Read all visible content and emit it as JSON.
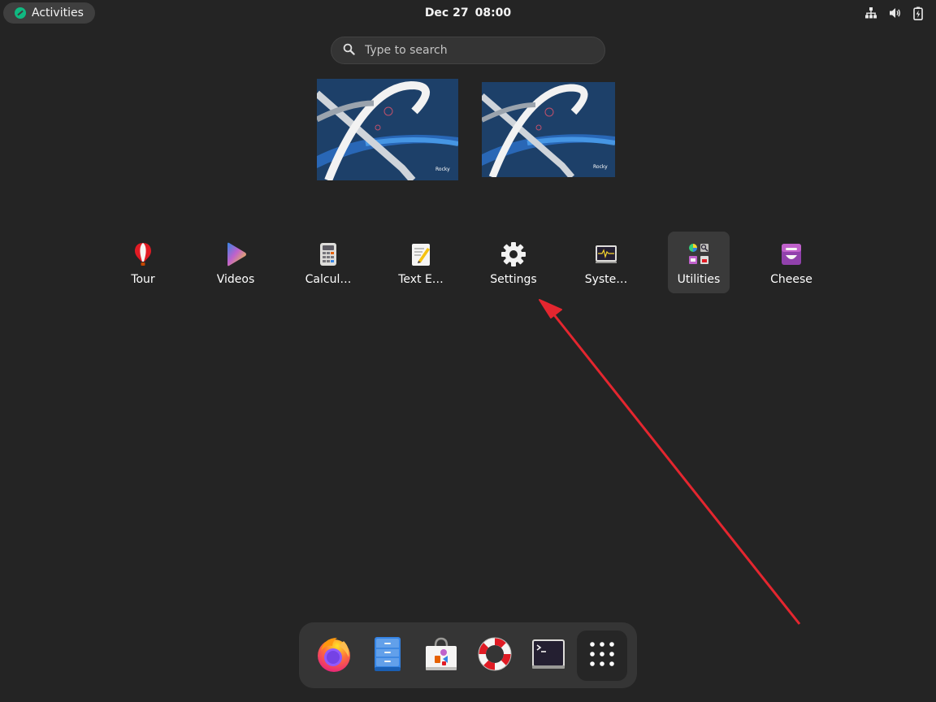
{
  "topbar": {
    "activities_label": "Activities",
    "date": "Dec 27",
    "time": "08:00",
    "tray_icons": [
      "network-wired-icon",
      "volume-icon",
      "battery-icon"
    ]
  },
  "search": {
    "placeholder": "Type to search",
    "icon": "search-icon"
  },
  "workspaces": [
    {
      "name": "workspace-1",
      "watermark": "Rocky"
    },
    {
      "name": "workspace-2",
      "watermark": "Rocky"
    }
  ],
  "apps": [
    {
      "label": "Tour",
      "icon": "balloon-icon"
    },
    {
      "label": "Videos",
      "icon": "play-icon"
    },
    {
      "label": "Calcul…",
      "icon": "calculator-icon"
    },
    {
      "label": "Text E…",
      "icon": "text-editor-icon"
    },
    {
      "label": "Settings",
      "icon": "gear-icon"
    },
    {
      "label": "Syste…",
      "icon": "system-monitor-icon"
    },
    {
      "label": "Utilities",
      "icon": "utilities-folder-icon",
      "highlighted": true
    },
    {
      "label": "Cheese",
      "icon": "cheese-icon"
    }
  ],
  "dock": [
    {
      "name": "firefox",
      "icon": "firefox-icon"
    },
    {
      "name": "files",
      "icon": "file-cabinet-icon"
    },
    {
      "name": "software",
      "icon": "software-bag-icon"
    },
    {
      "name": "help",
      "icon": "lifebuoy-icon"
    },
    {
      "name": "terminal",
      "icon": "terminal-icon"
    },
    {
      "name": "show-apps",
      "icon": "grid-dots-icon",
      "active": true
    }
  ],
  "colors": {
    "background": "#242424",
    "annotation_arrow": "#e4262f",
    "dock_bg": "#353535"
  }
}
